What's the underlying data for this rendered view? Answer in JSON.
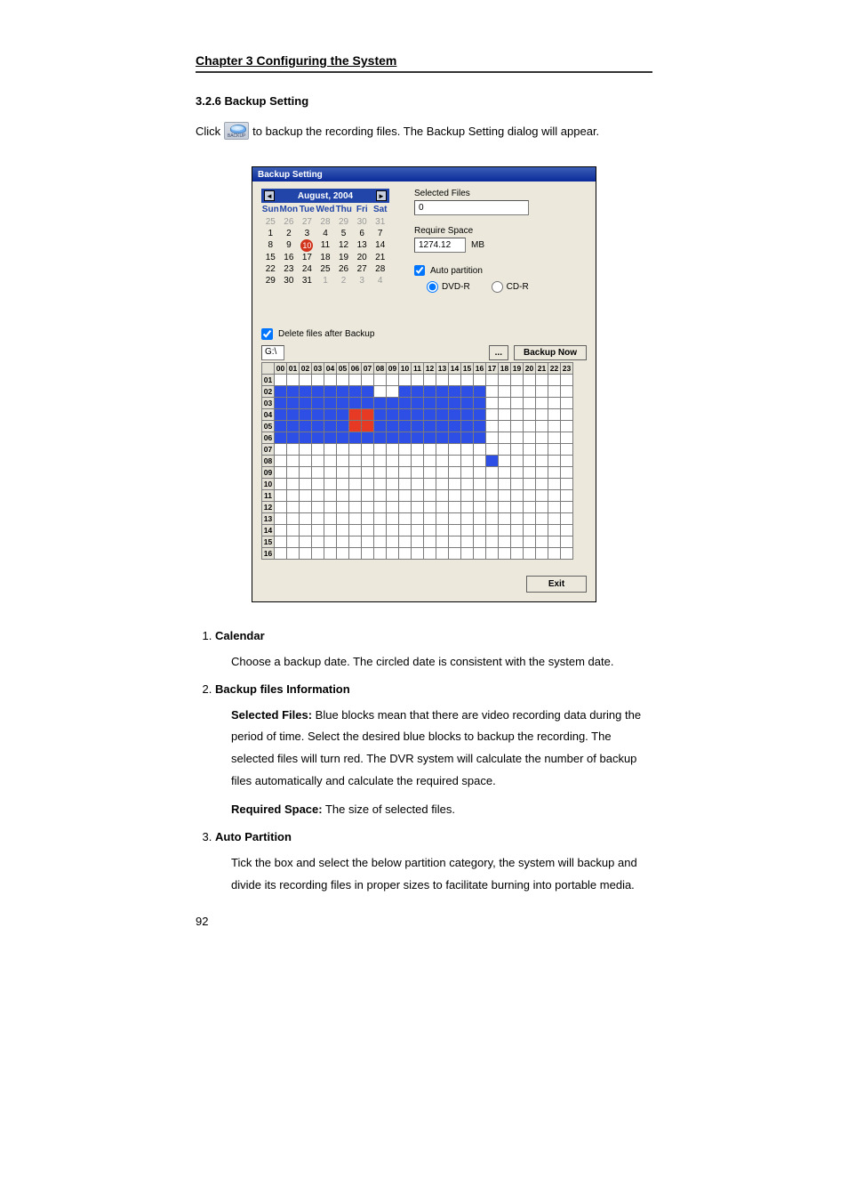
{
  "chapter_header": "Chapter 3    Configuring the System",
  "section_title": "3.2.6   Backup Setting",
  "click_pre": "Click",
  "click_post": "to backup the recording files. The Backup Setting dialog will appear.",
  "backup_icon_caption": "BACKUP",
  "dialog": {
    "title": "Backup Setting",
    "calendar": {
      "month": "August, 2004",
      "dow": [
        "Sun",
        "Mon",
        "Tue",
        "Wed",
        "Thu",
        "Fri",
        "Sat"
      ],
      "weeks": [
        [
          {
            "v": "25",
            "pm": true
          },
          {
            "v": "26",
            "pm": true
          },
          {
            "v": "27",
            "pm": true
          },
          {
            "v": "28",
            "pm": true
          },
          {
            "v": "29",
            "pm": true
          },
          {
            "v": "30",
            "pm": true
          },
          {
            "v": "31",
            "pm": true
          }
        ],
        [
          {
            "v": "1"
          },
          {
            "v": "2"
          },
          {
            "v": "3"
          },
          {
            "v": "4"
          },
          {
            "v": "5"
          },
          {
            "v": "6"
          },
          {
            "v": "7"
          }
        ],
        [
          {
            "v": "8"
          },
          {
            "v": "9"
          },
          {
            "v": "10",
            "today": true
          },
          {
            "v": "11"
          },
          {
            "v": "12"
          },
          {
            "v": "13"
          },
          {
            "v": "14"
          }
        ],
        [
          {
            "v": "15"
          },
          {
            "v": "16"
          },
          {
            "v": "17"
          },
          {
            "v": "18"
          },
          {
            "v": "19"
          },
          {
            "v": "20"
          },
          {
            "v": "21"
          }
        ],
        [
          {
            "v": "22"
          },
          {
            "v": "23"
          },
          {
            "v": "24"
          },
          {
            "v": "25"
          },
          {
            "v": "26"
          },
          {
            "v": "27"
          },
          {
            "v": "28"
          }
        ],
        [
          {
            "v": "29"
          },
          {
            "v": "30"
          },
          {
            "v": "31"
          },
          {
            "v": "1",
            "pm": true
          },
          {
            "v": "2",
            "pm": true
          },
          {
            "v": "3",
            "pm": true
          },
          {
            "v": "4",
            "pm": true
          }
        ]
      ]
    },
    "selected_files_label": "Selected Files",
    "selected_files_value": "0",
    "require_space_label": "Require Space",
    "require_space_value": "1274.12",
    "require_space_unit": "MB",
    "auto_partition_label": "Auto partition",
    "dvd_label": "DVD-R",
    "cd_label": "CD-R",
    "delete_label": "Delete files after Backup",
    "drive_value": "G:\\",
    "backup_now": "Backup Now",
    "exit": "Exit",
    "hours": [
      "00",
      "01",
      "02",
      "03",
      "04",
      "05",
      "06",
      "07",
      "08",
      "09",
      "10",
      "11",
      "12",
      "13",
      "14",
      "15",
      "16",
      "17",
      "18",
      "19",
      "20",
      "21",
      "22",
      "23"
    ],
    "rows": [
      "01",
      "02",
      "03",
      "04",
      "05",
      "06",
      "07",
      "08",
      "09",
      "10",
      "11",
      "12",
      "13",
      "14",
      "15",
      "16"
    ],
    "cells": {
      "01": [
        "",
        "",
        "",
        "",
        "",
        "",
        "",
        "",
        "",
        "",
        "",
        "",
        "",
        "",
        "",
        "",
        "",
        "",
        "",
        "",
        "",
        "",
        "",
        ""
      ],
      "02": [
        "b",
        "b",
        "b",
        "b",
        "b",
        "b",
        "b",
        "b",
        "",
        "",
        "b",
        "b",
        "b",
        "b",
        "b",
        "b",
        "b",
        "",
        "",
        "",
        "",
        "",
        "",
        ""
      ],
      "03": [
        "b",
        "b",
        "b",
        "b",
        "b",
        "b",
        "b",
        "b",
        "b",
        "b",
        "b",
        "b",
        "b",
        "b",
        "b",
        "b",
        "b",
        "",
        "",
        "",
        "",
        "",
        "",
        ""
      ],
      "04": [
        "b",
        "b",
        "b",
        "b",
        "b",
        "b",
        "r",
        "r",
        "b",
        "b",
        "b",
        "b",
        "b",
        "b",
        "b",
        "b",
        "b",
        "",
        "",
        "",
        "",
        "",
        "",
        ""
      ],
      "05": [
        "b",
        "b",
        "b",
        "b",
        "b",
        "b",
        "r",
        "r",
        "b",
        "b",
        "b",
        "b",
        "b",
        "b",
        "b",
        "b",
        "b",
        "",
        "",
        "",
        "",
        "",
        "",
        ""
      ],
      "06": [
        "b",
        "b",
        "b",
        "b",
        "b",
        "b",
        "b",
        "b",
        "b",
        "b",
        "b",
        "b",
        "b",
        "b",
        "b",
        "b",
        "b",
        "",
        "",
        "",
        "",
        "",
        "",
        ""
      ],
      "07": [
        "",
        "",
        "",
        "",
        "",
        "",
        "",
        "",
        "",
        "",
        "",
        "",
        "",
        "",
        "",
        "",
        "",
        "",
        "",
        "",
        "",
        "",
        "",
        ""
      ],
      "08": [
        "",
        "",
        "",
        "",
        "",
        "",
        "",
        "",
        "",
        "",
        "",
        "",
        "",
        "",
        "",
        "",
        "",
        "b",
        "",
        "",
        "",
        "",
        "",
        ""
      ],
      "09": [
        "",
        "",
        "",
        "",
        "",
        "",
        "",
        "",
        "",
        "",
        "",
        "",
        "",
        "",
        "",
        "",
        "",
        "",
        "",
        "",
        "",
        "",
        "",
        ""
      ],
      "10": [
        "",
        "",
        "",
        "",
        "",
        "",
        "",
        "",
        "",
        "",
        "",
        "",
        "",
        "",
        "",
        "",
        "",
        "",
        "",
        "",
        "",
        "",
        "",
        ""
      ],
      "11": [
        "",
        "",
        "",
        "",
        "",
        "",
        "",
        "",
        "",
        "",
        "",
        "",
        "",
        "",
        "",
        "",
        "",
        "",
        "",
        "",
        "",
        "",
        "",
        ""
      ],
      "12": [
        "",
        "",
        "",
        "",
        "",
        "",
        "",
        "",
        "",
        "",
        "",
        "",
        "",
        "",
        "",
        "",
        "",
        "",
        "",
        "",
        "",
        "",
        "",
        ""
      ],
      "13": [
        "",
        "",
        "",
        "",
        "",
        "",
        "",
        "",
        "",
        "",
        "",
        "",
        "",
        "",
        "",
        "",
        "",
        "",
        "",
        "",
        "",
        "",
        "",
        ""
      ],
      "14": [
        "",
        "",
        "",
        "",
        "",
        "",
        "",
        "",
        "",
        "",
        "",
        "",
        "",
        "",
        "",
        "",
        "",
        "",
        "",
        "",
        "",
        "",
        "",
        ""
      ],
      "15": [
        "",
        "",
        "",
        "",
        "",
        "",
        "",
        "",
        "",
        "",
        "",
        "",
        "",
        "",
        "",
        "",
        "",
        "",
        "",
        "",
        "",
        "",
        "",
        ""
      ],
      "16": [
        "",
        "",
        "",
        "",
        "",
        "",
        "",
        "",
        "",
        "",
        "",
        "",
        "",
        "",
        "",
        "",
        "",
        "",
        "",
        "",
        "",
        "",
        "",
        ""
      ]
    }
  },
  "list": {
    "1": {
      "title": "Calendar",
      "p1": "Choose a backup date. The circled date is consistent with the system date."
    },
    "2": {
      "title": "Backup files Information",
      "sel_lead": "Selected Files:",
      "sel_body": " Blue blocks mean that there are video recording data during the period of time. Select the desired blue blocks to backup the recording. The selected files will turn red. The DVR system will calculate the number of backup files automatically and calculate the required space.",
      "req_lead": "Required Space:",
      "req_body": "   The size of selected files."
    },
    "3": {
      "title": "Auto Partition",
      "p1": "Tick the box and select the below partition category, the system will backup and divide its recording files in proper sizes to facilitate burning into portable media."
    }
  },
  "page_number": "92"
}
